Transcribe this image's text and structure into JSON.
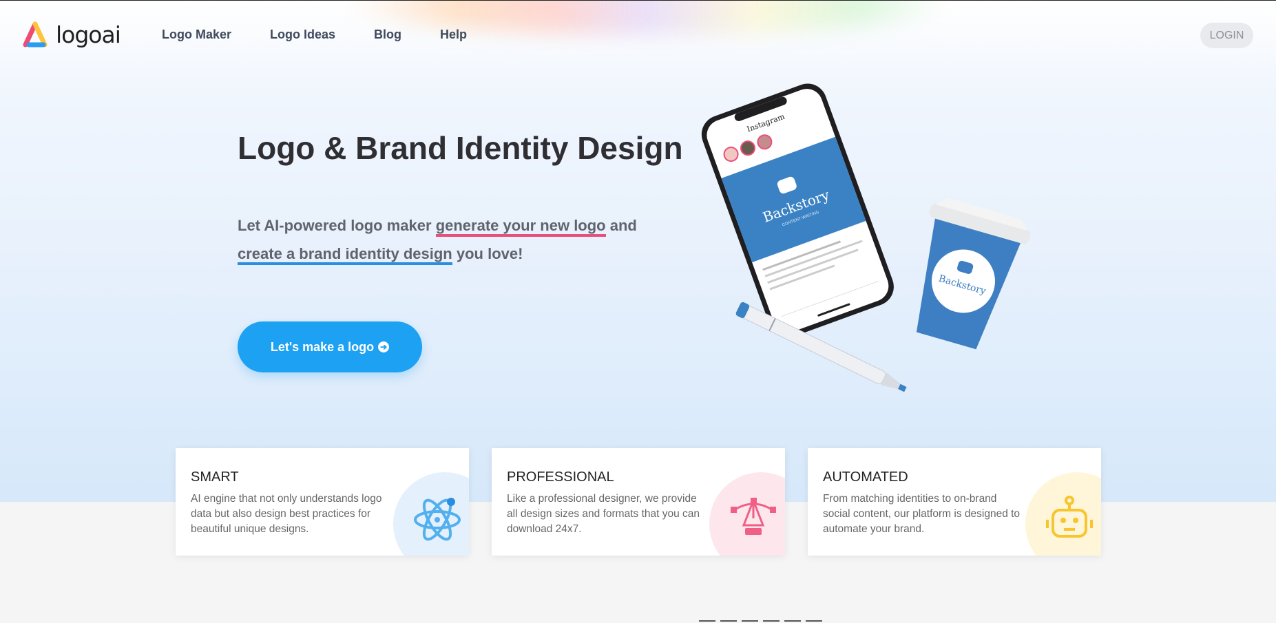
{
  "brand": {
    "name": "logoai"
  },
  "nav": {
    "items": [
      {
        "label": "Logo Maker"
      },
      {
        "label": "Logo Ideas"
      },
      {
        "label": "Blog"
      },
      {
        "label": "Help"
      }
    ],
    "login": "LOGIN"
  },
  "hero": {
    "title": "Logo & Brand Identity Design",
    "sub_1": "Let AI-powered logo maker ",
    "sub_highlight_1": "generate your new logo",
    "sub_2": " and ",
    "sub_highlight_2": "create a brand identity design",
    "sub_3": " you love!",
    "cta": "Let's make a logo"
  },
  "mockup": {
    "app_name": "Instagram",
    "brand_name": "Backstory",
    "brand_tagline": "CONTENT WRITING"
  },
  "features": [
    {
      "title": "SMART",
      "text": "AI engine that not only understands logo data but also design best practices for beautiful unique designs.",
      "icon": "atom-icon",
      "blob_color": "#e4f1fd",
      "icon_color": "#52b0ee"
    },
    {
      "title": "PROFESSIONAL",
      "text": "Like a professional designer, we provide all design sizes and formats that you can download 24x7.",
      "icon": "pen-tool-icon",
      "blob_color": "#fde7ec",
      "icon_color": "#ef5f86"
    },
    {
      "title": "AUTOMATED",
      "text": "From matching identities to on-brand social content, our platform is designed to automate your brand.",
      "icon": "robot-icon",
      "blob_color": "#fff5d8",
      "icon_color": "#f7c52d"
    }
  ],
  "colors": {
    "accent": "#1da1f2",
    "underline_pink": "#e8507c",
    "underline_blue": "#2a8ee0"
  }
}
